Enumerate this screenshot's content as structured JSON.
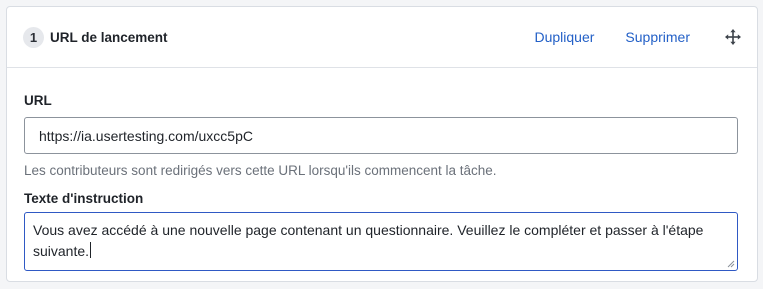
{
  "card": {
    "step_number": "1",
    "title": "URL de lancement",
    "duplicate_label": "Dupliquer",
    "delete_label": "Supprimer",
    "move_icon": "move-icon"
  },
  "url_field": {
    "label": "URL",
    "value": "https://ia.usertesting.com/uxcc5pC",
    "help": "Les contributeurs sont redirigés vers cette URL lorsqu'ils commencent la tâche."
  },
  "instruction_field": {
    "label": "Texte d'instruction",
    "value": "Vous avez accédé à une nouvelle page contenant un questionnaire. Veuillez le compléter et passer à l'étape suivante."
  },
  "colors": {
    "link": "#2360c7",
    "focus_border": "#2f59c4",
    "help_text": "#6b717a"
  }
}
